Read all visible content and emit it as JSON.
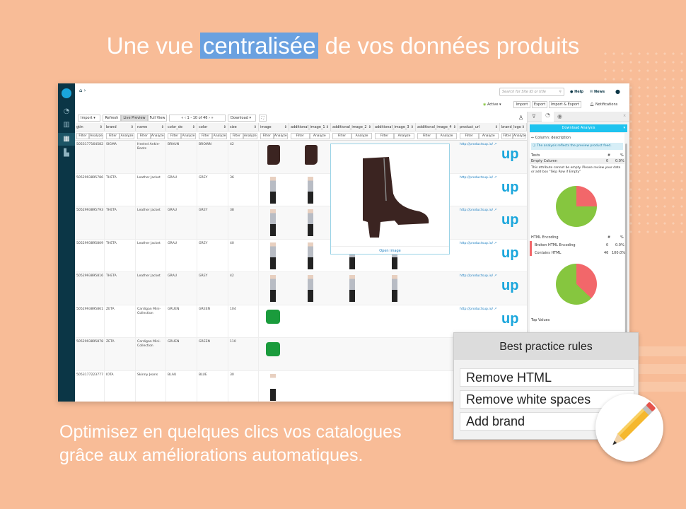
{
  "headline": {
    "before": "Une vue ",
    "highlight": "centralisée",
    "after": " de vos données produits"
  },
  "subtitle": [
    "Optimisez en quelques clics vos catalogues",
    "grâce aux améliorations automatiques."
  ],
  "topbar": {
    "search_placeholder": "Search for Site ID or title",
    "help": "Help",
    "news": "News",
    "active": "Active ▾",
    "import": "Import",
    "export": "Export",
    "import_export": "Import & Export",
    "notifications": "Notifications"
  },
  "toolbar": {
    "import": "Import",
    "refresh": "Refresh",
    "live_preview": "Live Preview",
    "full_view": "Full View",
    "pagination": "1 - 10 of 46",
    "download": "Download"
  },
  "columns": [
    "gtin",
    "brand",
    "name",
    "color_de",
    "color",
    "size",
    "image",
    "additional_image_1",
    "additional_image_2",
    "additional_image_3",
    "additional_image_4",
    "product_url",
    "brand_logo"
  ],
  "filter_label": "Filter",
  "analyze_label": "Analyze",
  "rows": [
    [
      "5053177164582",
      "SIGMA",
      "Heeled Ankle-Boots",
      "BRAUN",
      "BROWN",
      "42"
    ],
    [
      "5052993895786",
      "THETA",
      "Leather Jacket",
      "GRAU",
      "GREY",
      "36"
    ],
    [
      "5052993895793",
      "THETA",
      "Leather Jacket",
      "GRAU",
      "GREY",
      "38"
    ],
    [
      "5052993895809",
      "THETA",
      "Leather Jacket",
      "GRAU",
      "GREY",
      "40"
    ],
    [
      "5052993895816",
      "THETA",
      "Leather Jacket",
      "GRAU",
      "GREY",
      "42"
    ],
    [
      "5052993895861",
      "ZETA",
      "Cardigan Mini-Collection",
      "GRUEN",
      "GREEN",
      "104"
    ],
    [
      "5052993895878",
      "ZETA",
      "Cardigan Mini-Collection",
      "GRUEN",
      "GREEN",
      "110"
    ],
    [
      "5053177223777",
      "IOTA",
      "Skinny Jeans",
      "BLAU",
      "BLUE",
      "30"
    ]
  ],
  "product_url": "http://productsup.io/",
  "brand_logo_text": "up",
  "popup": {
    "open_image": "Open image"
  },
  "analysis": {
    "download": "Download Analysis",
    "column": "Column: description",
    "info": "The analysis reflects the preview product feed.",
    "tests": "Tests",
    "hash": "#",
    "pct": "%",
    "empty": {
      "label": "Empty Column",
      "count": "0",
      "percent": "0.0%"
    },
    "empty_msg": "This attribute cannot be empty. Please review your data or add box \"Skip Row if Empty\"",
    "html": "HTML Encoding",
    "broken": {
      "label": "Broken HTML Encoding",
      "count": "0",
      "percent": "0.0%"
    },
    "contains": {
      "label": "Contains HTML",
      "count": "46",
      "percent": "100.0%"
    },
    "top_values": "Top Values",
    "pie1_red_fraction": 0.25,
    "pie2_red_fraction": 0.37,
    "colors": {
      "red": "#f2676a",
      "green": "#86c63f",
      "accent": "#1ec3ef"
    }
  },
  "best_practice": {
    "title": "Best practice rules",
    "rules": [
      "Remove HTML",
      "Remove white spaces",
      "Add brand"
    ]
  }
}
